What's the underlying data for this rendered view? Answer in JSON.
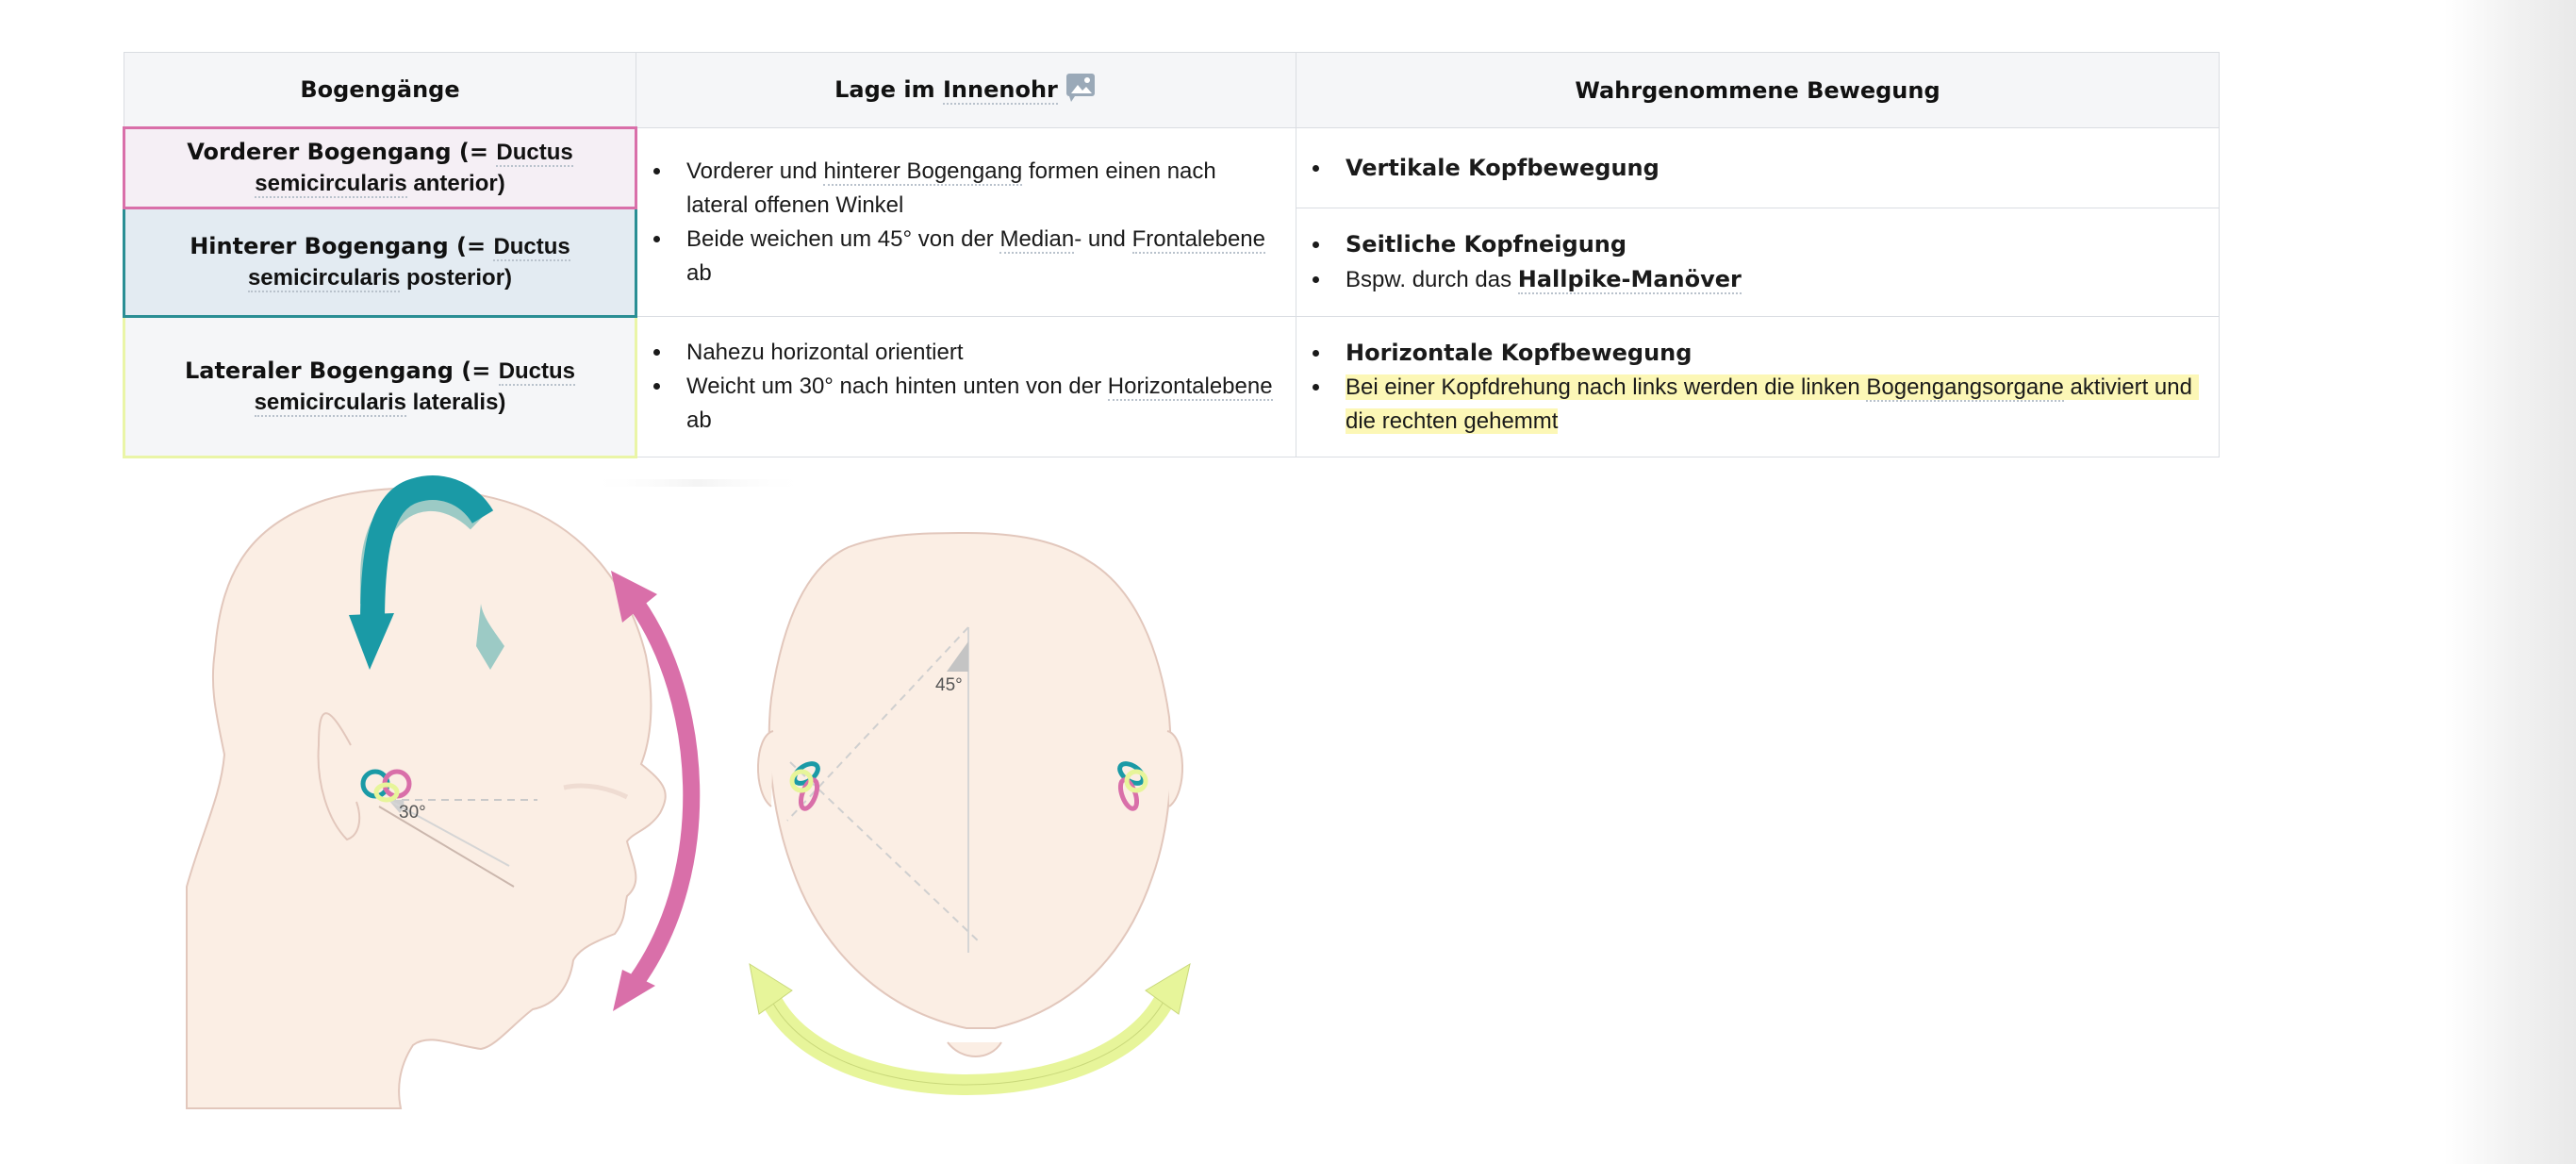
{
  "table": {
    "headers": {
      "col1": "Bogengänge",
      "col2_prefix": "Lage im ",
      "col2_link": "Innenohr",
      "col3": "Wahrgenommene Bewegung"
    },
    "rows": [
      {
        "name_a": "Vorderer Bogengang (= ",
        "name_link": "Ductus semicircularis",
        "name_b": " anterior)",
        "bewegung": {
          "bold": "Vertikale Kopfbewegung"
        }
      },
      {
        "name_a": "Hinterer Bogengang (= ",
        "name_link": "Ductus semicircularis",
        "name_b": " posterior)",
        "bewegung": {
          "bold": "Seitliche Kopfneigung",
          "line2_prefix": "Bspw. durch das ",
          "line2_link": "Hallpike-Manöver"
        }
      },
      {
        "name_a": "Lateraler Bogengang (= ",
        "name_link": "Ductus semicircularis",
        "name_b": " lateralis)",
        "bewegung": {
          "bold": "Horizontale Kopfbewegung",
          "hl_a": "Bei einer Kopfdrehung nach links werden die linken ",
          "hl_link": "Bogengangsorgane",
          "hl_b": " aktiviert und die rechten gehemmt"
        }
      }
    ],
    "lage_upper": {
      "item1_a": "Vorderer und ",
      "item1_link": "hinterer Bogengang",
      "item1_b": " formen einen nach lateral offenen Winkel",
      "item2_a": "Beide weichen um 45° von der ",
      "item2_link1": "Median",
      "item2_mid": "- und ",
      "item2_link2": "Frontalebene",
      "item2_b": " ab"
    },
    "lage_lower": {
      "item1": "Nahezu horizontal orientiert",
      "item2_a": "Weicht um 30° nach hinten unten von der ",
      "item2_link": "Horizontalebene",
      "item2_b": " ab"
    }
  },
  "figure": {
    "side_angle_label": "30°",
    "top_angle_label": "45°",
    "colors": {
      "anterior": "#d96fa9",
      "posterior": "#1a9aa6",
      "posterior_light": "#9ccac5",
      "lateral": "#e7f59a",
      "skin": "#fbeee4",
      "outline": "#e2c7bc"
    }
  },
  "icons": {
    "header_image_icon": "image-icon"
  }
}
